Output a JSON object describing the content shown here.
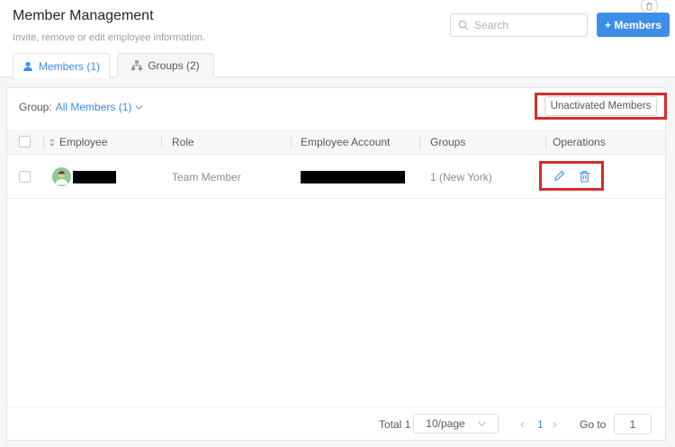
{
  "page": {
    "title": "Member Management",
    "subtitle": "Invite, remove or edit employee information."
  },
  "header": {
    "search_placeholder": "Search",
    "members_button": "+ Members",
    "icons": {
      "top_right": "trash-icon",
      "search": "search-icon"
    }
  },
  "tabs": [
    {
      "label": "Members (1)",
      "active": true,
      "icon": "person-icon"
    },
    {
      "label": "Groups (2)",
      "active": false,
      "icon": "org-chart-icon"
    }
  ],
  "toolbar": {
    "group_label": "Group:",
    "group_value": "All Members (1)",
    "group_dropdown_icon": "chevron-down-icon",
    "unactivated_button": "Unactivated Members"
  },
  "table": {
    "headers": [
      "Employee",
      "Role",
      "Employee Account",
      "Groups",
      "Operations"
    ],
    "sort_icon": "sort-arrows-icon",
    "rows": [
      {
        "employee_redacted": true,
        "role": "Team Member",
        "account_redacted": true,
        "groups": "1 (New York)",
        "operations": [
          "edit-icon",
          "delete-icon"
        ],
        "checked": false
      }
    ]
  },
  "pagination": {
    "total": "Total 1",
    "page_size": "10/page",
    "prev": "‹",
    "current_page": "1",
    "next": "›",
    "goto_label": "Go to",
    "goto_value": "1"
  },
  "annotations": {
    "highlight_color": "#d62b2b",
    "highlighted": [
      "unactivated-members-button",
      "row-operations"
    ]
  },
  "colors": {
    "accent": "#3d8deb",
    "annotation_red": "#d62b2b",
    "avatar_bg": "#8fca8f"
  }
}
